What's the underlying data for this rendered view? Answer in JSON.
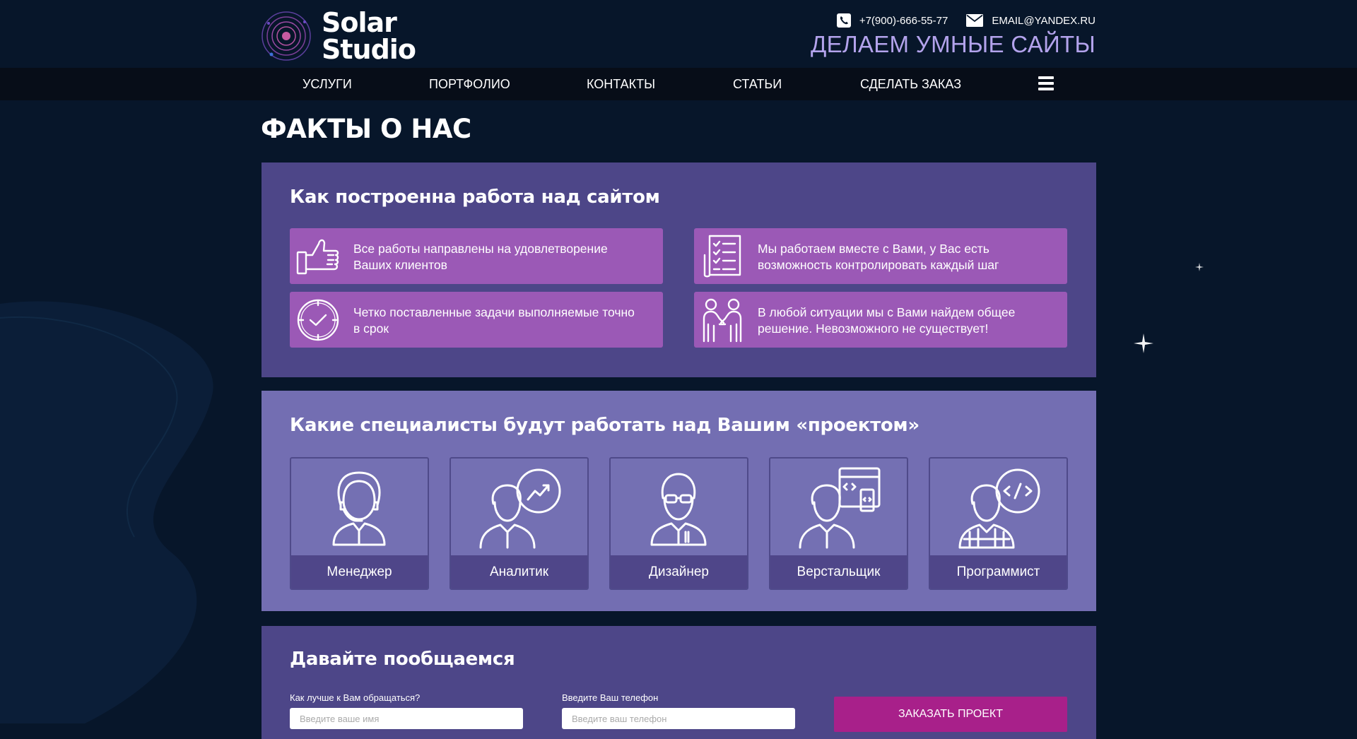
{
  "brand": {
    "line1": "Solar",
    "line2": "Studio"
  },
  "header": {
    "phone": "+7(900)-666-55-77",
    "email": "EMAIL@YANDEX.RU",
    "tagline": "ДЕЛАЕМ УМНЫЕ САЙТЫ"
  },
  "nav": {
    "items": [
      "УСЛУГИ",
      "ПОРТФОЛИО",
      "КОНТАКТЫ",
      "СТАТЬИ",
      "СДЕЛАТЬ ЗАКАЗ"
    ],
    "menu_icon": "hamburger-menu-icon"
  },
  "page": {
    "title": "ФАКТЫ О НАС"
  },
  "work": {
    "title": "Как построенна работа над сайтом",
    "facts": [
      {
        "icon": "thumbs-up-icon",
        "text": "Все работы направлены на удовлетворение Ваших клиентов"
      },
      {
        "icon": "checklist-icon",
        "text": "Мы работаем вместе с Вами, у Вас есть возможность контролировать каждый шаг"
      },
      {
        "icon": "clock-check-icon",
        "text": "Четко поставленные задачи выполняемые точно в срок"
      },
      {
        "icon": "handshake-people-icon",
        "text": "В любой ситуации мы с Вами найдем общее решение. Невозможного не существует!"
      }
    ]
  },
  "specialists": {
    "title": "Какие специалисты будут работать над Вашим «проектом»",
    "items": [
      {
        "icon": "manager-headset-icon",
        "label": "Менеджер"
      },
      {
        "icon": "analyst-chart-icon",
        "label": "Аналитик"
      },
      {
        "icon": "designer-glasses-icon",
        "label": "Дизайнер"
      },
      {
        "icon": "coder-layout-icon",
        "label": "Верстальщик"
      },
      {
        "icon": "programmer-code-icon",
        "label": "Программист"
      }
    ]
  },
  "contact_form": {
    "title": "Давайте пообщаемся",
    "name_label": "Как лучше к Вам обращаться?",
    "name_placeholder": "Введите ваше имя",
    "phone_label": "Введите Ваш телефон",
    "phone_placeholder": "Введите ваш телефон",
    "submit": "ЗАКАЗАТЬ ПРОЕКТ"
  },
  "colors": {
    "background": "#07162a",
    "navbar": "#070d18",
    "panel_dark": "#4d4688",
    "panel_light": "#736eb2",
    "fact_card": "#9b59b6",
    "accent_button": "#a8208a",
    "tagline": "#b3a3ec"
  }
}
